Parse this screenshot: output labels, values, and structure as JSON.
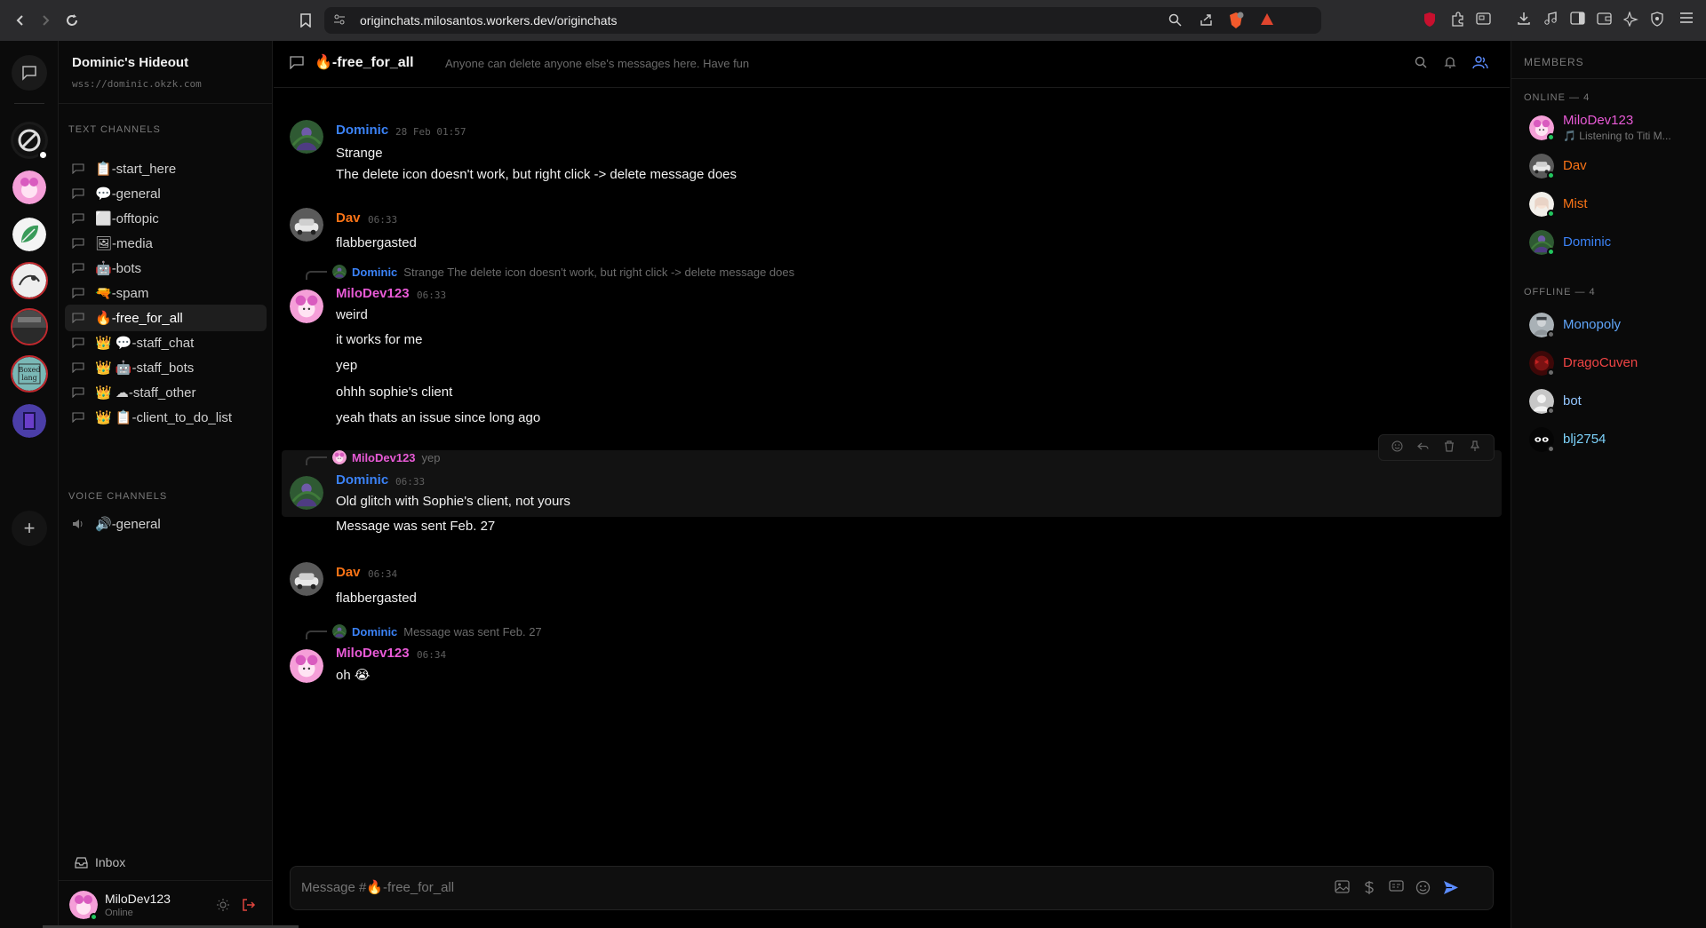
{
  "browser": {
    "url": "originchats.milosantos.workers.dev/originchats"
  },
  "server": {
    "name": "Dominic's Hideout",
    "address": "wss://dominic.okzk.com"
  },
  "channels": {
    "text_header": "TEXT CHANNELS",
    "voice_header": "VOICE CHANNELS",
    "text": [
      {
        "emoji": "📋",
        "label": "-start_here"
      },
      {
        "emoji": "💬",
        "label": "-general"
      },
      {
        "emoji": "⬜",
        "label": "-offtopic"
      },
      {
        "emoji": "🖼",
        "label": "-media"
      },
      {
        "emoji": "🤖",
        "label": "-bots"
      },
      {
        "emoji": "🔫",
        "label": "-spam"
      },
      {
        "emoji": "🔥",
        "label": "-free_for_all"
      },
      {
        "emoji": "👑 💬",
        "label": "-staff_chat"
      },
      {
        "emoji": "👑 🤖",
        "label": "-staff_bots"
      },
      {
        "emoji": "👑 ☁",
        "label": "-staff_other"
      },
      {
        "emoji": "👑 📋",
        "label": "-client_to_do_list"
      }
    ],
    "voice": [
      {
        "emoji": "🔊",
        "label": "-general"
      }
    ],
    "active_index": 6
  },
  "sidebar_footer": {
    "inbox_label": "Inbox",
    "username": "MiloDev123",
    "status": "Online"
  },
  "chat": {
    "title_emoji": "🔥",
    "title": "-free_for_all",
    "topic": "Anyone can delete anyone else's messages here. Have fun",
    "placeholder": "Message #🔥-free_for_all"
  },
  "messages": [
    {
      "author": "Dominic",
      "time": "28 Feb 01:57",
      "lines": [
        "Strange",
        "The delete icon doesn't work, but right click -> delete message does"
      ]
    },
    {
      "author": "Dav",
      "time": "06:33",
      "lines": [
        "flabbergasted"
      ]
    },
    {
      "reply_to": "Dominic",
      "reply_text": "Strange The delete icon doesn't work, but right click -> delete message does",
      "author": "MiloDev123",
      "time": "06:33",
      "lines": [
        "weird",
        "it works for me",
        "yep",
        "ohhh sophie's client",
        "yeah thats an issue since long ago"
      ]
    },
    {
      "reply_to": "MiloDev123",
      "reply_text": "yep",
      "author": "Dominic",
      "time": "06:33",
      "lines": [
        "Old glitch with Sophie's client, not yours",
        "Message was sent Feb. 27"
      ]
    },
    {
      "author": "Dav",
      "time": "06:34",
      "lines": [
        "flabbergasted"
      ]
    },
    {
      "reply_to": "Dominic",
      "reply_text": "Message was sent Feb. 27",
      "author": "MiloDev123",
      "time": "06:34",
      "lines": [
        "oh 😭"
      ]
    }
  ],
  "members": {
    "title": "MEMBERS",
    "online_header": "ONLINE — 4",
    "offline_header": "OFFLINE — 4",
    "online": [
      {
        "name": "MiloDev123",
        "activity": "🎵 Listening to Titi M..."
      },
      {
        "name": "Dav"
      },
      {
        "name": "Mist"
      },
      {
        "name": "Dominic"
      }
    ],
    "offline": [
      {
        "name": "Monopoly"
      },
      {
        "name": "DragoCuven"
      },
      {
        "name": "bot"
      },
      {
        "name": "blj2754"
      }
    ]
  },
  "colors": {
    "dominic": "#3b82f6",
    "dav": "#f97316",
    "milodev": "#e85ad6",
    "mist": "#f97316",
    "monopoly": "#60a5fa",
    "dragocuven": "#ef4444",
    "bot": "#93c5fd",
    "blj2754": "#7dd3fc",
    "online": "#22c55e",
    "accent": "#5b8cff"
  }
}
